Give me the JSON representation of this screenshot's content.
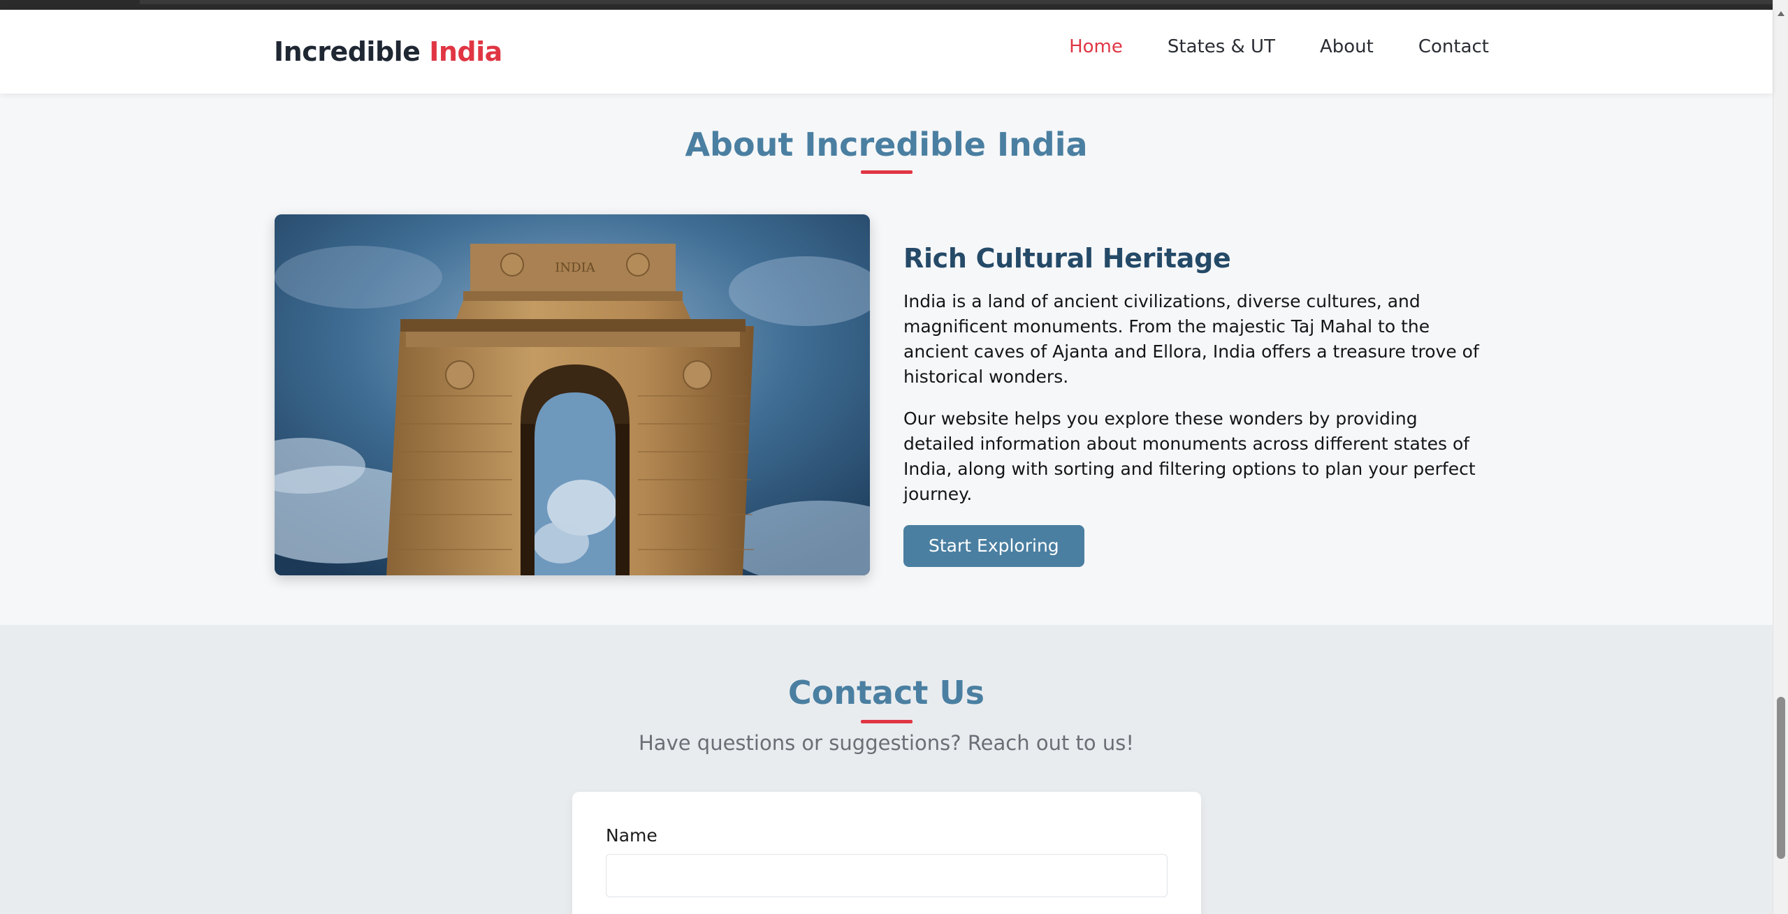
{
  "header": {
    "brand_main": "Incredible",
    "brand_accent": "India",
    "nav": [
      {
        "label": "Home",
        "active": true
      },
      {
        "label": "States & UT",
        "active": false
      },
      {
        "label": "About",
        "active": false
      },
      {
        "label": "Contact",
        "active": false
      }
    ]
  },
  "about": {
    "title": "About Incredible India",
    "heading": "Rich Cultural Heritage",
    "paragraph1": "India is a land of ancient civilizations, diverse cultures, and magnificent monuments. From the majestic Taj Mahal to the ancient caves of Ajanta and Ellora, India offers a treasure trove of historical wonders.",
    "paragraph2": "Our website helps you explore these wonders by providing detailed information about monuments across different states of India, along with sorting and filtering options to plan your perfect journey.",
    "button_label": "Start Exploring",
    "image_inscription": "INDIA"
  },
  "contact": {
    "title": "Contact Us",
    "subtitle": "Have questions or suggestions? Reach out to us!",
    "name_label": "Name",
    "name_value": ""
  },
  "colors": {
    "accent": "#e03644",
    "primary": "#4a7fa1",
    "heading_dark": "#254a68"
  }
}
